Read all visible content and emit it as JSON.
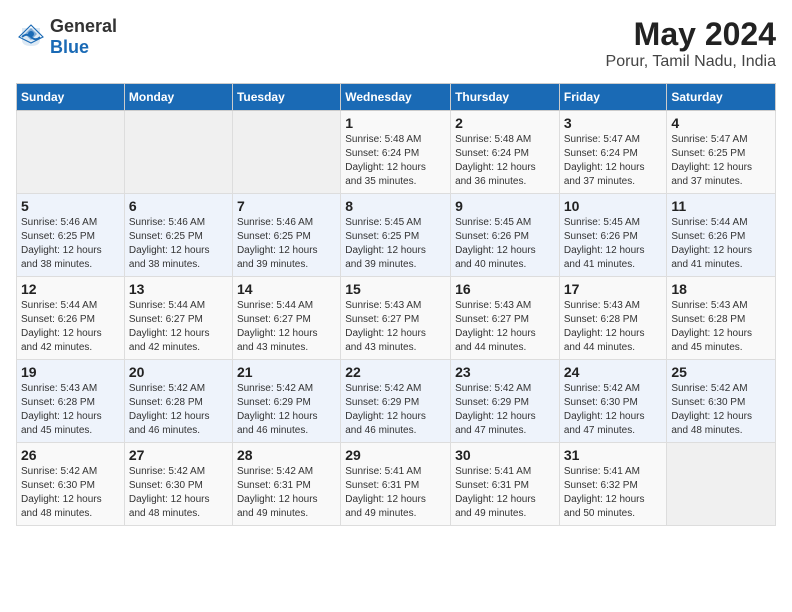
{
  "logo": {
    "general": "General",
    "blue": "Blue"
  },
  "title": "May 2024",
  "subtitle": "Porur, Tamil Nadu, India",
  "days_of_week": [
    "Sunday",
    "Monday",
    "Tuesday",
    "Wednesday",
    "Thursday",
    "Friday",
    "Saturday"
  ],
  "weeks": [
    [
      {
        "day": "",
        "info": ""
      },
      {
        "day": "",
        "info": ""
      },
      {
        "day": "",
        "info": ""
      },
      {
        "day": "1",
        "info": "Sunrise: 5:48 AM\nSunset: 6:24 PM\nDaylight: 12 hours\nand 35 minutes."
      },
      {
        "day": "2",
        "info": "Sunrise: 5:48 AM\nSunset: 6:24 PM\nDaylight: 12 hours\nand 36 minutes."
      },
      {
        "day": "3",
        "info": "Sunrise: 5:47 AM\nSunset: 6:24 PM\nDaylight: 12 hours\nand 37 minutes."
      },
      {
        "day": "4",
        "info": "Sunrise: 5:47 AM\nSunset: 6:25 PM\nDaylight: 12 hours\nand 37 minutes."
      }
    ],
    [
      {
        "day": "5",
        "info": "Sunrise: 5:46 AM\nSunset: 6:25 PM\nDaylight: 12 hours\nand 38 minutes."
      },
      {
        "day": "6",
        "info": "Sunrise: 5:46 AM\nSunset: 6:25 PM\nDaylight: 12 hours\nand 38 minutes."
      },
      {
        "day": "7",
        "info": "Sunrise: 5:46 AM\nSunset: 6:25 PM\nDaylight: 12 hours\nand 39 minutes."
      },
      {
        "day": "8",
        "info": "Sunrise: 5:45 AM\nSunset: 6:25 PM\nDaylight: 12 hours\nand 39 minutes."
      },
      {
        "day": "9",
        "info": "Sunrise: 5:45 AM\nSunset: 6:26 PM\nDaylight: 12 hours\nand 40 minutes."
      },
      {
        "day": "10",
        "info": "Sunrise: 5:45 AM\nSunset: 6:26 PM\nDaylight: 12 hours\nand 41 minutes."
      },
      {
        "day": "11",
        "info": "Sunrise: 5:44 AM\nSunset: 6:26 PM\nDaylight: 12 hours\nand 41 minutes."
      }
    ],
    [
      {
        "day": "12",
        "info": "Sunrise: 5:44 AM\nSunset: 6:26 PM\nDaylight: 12 hours\nand 42 minutes."
      },
      {
        "day": "13",
        "info": "Sunrise: 5:44 AM\nSunset: 6:27 PM\nDaylight: 12 hours\nand 42 minutes."
      },
      {
        "day": "14",
        "info": "Sunrise: 5:44 AM\nSunset: 6:27 PM\nDaylight: 12 hours\nand 43 minutes."
      },
      {
        "day": "15",
        "info": "Sunrise: 5:43 AM\nSunset: 6:27 PM\nDaylight: 12 hours\nand 43 minutes."
      },
      {
        "day": "16",
        "info": "Sunrise: 5:43 AM\nSunset: 6:27 PM\nDaylight: 12 hours\nand 44 minutes."
      },
      {
        "day": "17",
        "info": "Sunrise: 5:43 AM\nSunset: 6:28 PM\nDaylight: 12 hours\nand 44 minutes."
      },
      {
        "day": "18",
        "info": "Sunrise: 5:43 AM\nSunset: 6:28 PM\nDaylight: 12 hours\nand 45 minutes."
      }
    ],
    [
      {
        "day": "19",
        "info": "Sunrise: 5:43 AM\nSunset: 6:28 PM\nDaylight: 12 hours\nand 45 minutes."
      },
      {
        "day": "20",
        "info": "Sunrise: 5:42 AM\nSunset: 6:28 PM\nDaylight: 12 hours\nand 46 minutes."
      },
      {
        "day": "21",
        "info": "Sunrise: 5:42 AM\nSunset: 6:29 PM\nDaylight: 12 hours\nand 46 minutes."
      },
      {
        "day": "22",
        "info": "Sunrise: 5:42 AM\nSunset: 6:29 PM\nDaylight: 12 hours\nand 46 minutes."
      },
      {
        "day": "23",
        "info": "Sunrise: 5:42 AM\nSunset: 6:29 PM\nDaylight: 12 hours\nand 47 minutes."
      },
      {
        "day": "24",
        "info": "Sunrise: 5:42 AM\nSunset: 6:30 PM\nDaylight: 12 hours\nand 47 minutes."
      },
      {
        "day": "25",
        "info": "Sunrise: 5:42 AM\nSunset: 6:30 PM\nDaylight: 12 hours\nand 48 minutes."
      }
    ],
    [
      {
        "day": "26",
        "info": "Sunrise: 5:42 AM\nSunset: 6:30 PM\nDaylight: 12 hours\nand 48 minutes."
      },
      {
        "day": "27",
        "info": "Sunrise: 5:42 AM\nSunset: 6:30 PM\nDaylight: 12 hours\nand 48 minutes."
      },
      {
        "day": "28",
        "info": "Sunrise: 5:42 AM\nSunset: 6:31 PM\nDaylight: 12 hours\nand 49 minutes."
      },
      {
        "day": "29",
        "info": "Sunrise: 5:41 AM\nSunset: 6:31 PM\nDaylight: 12 hours\nand 49 minutes."
      },
      {
        "day": "30",
        "info": "Sunrise: 5:41 AM\nSunset: 6:31 PM\nDaylight: 12 hours\nand 49 minutes."
      },
      {
        "day": "31",
        "info": "Sunrise: 5:41 AM\nSunset: 6:32 PM\nDaylight: 12 hours\nand 50 minutes."
      },
      {
        "day": "",
        "info": ""
      }
    ]
  ]
}
